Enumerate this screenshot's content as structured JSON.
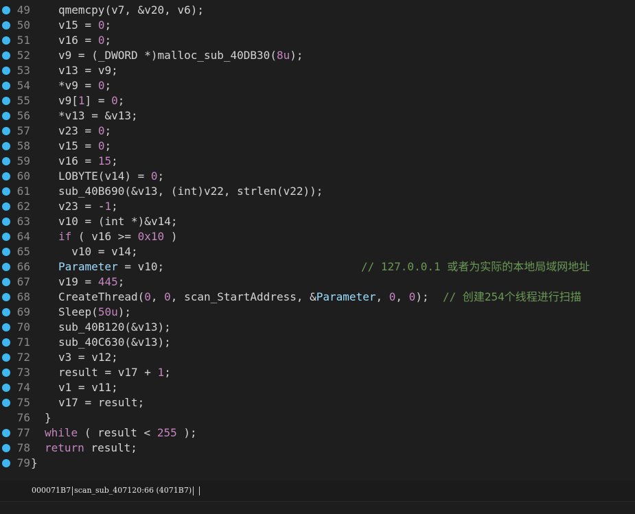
{
  "colors": {
    "background": "#1e1e1e",
    "breakpoint_dot": "#3fb7f1",
    "line_number": "#8a8a8a",
    "text": "#d4d4d4",
    "number": "#c586c0",
    "keyword": "#c586c0",
    "variable": "#9cdcfe",
    "comment": "#6a9955"
  },
  "lines": [
    {
      "num": "49",
      "bp": true,
      "text": "qmemcpy(v7, &v20, v6);"
    },
    {
      "num": "50",
      "bp": true,
      "text": "v15 = 0;"
    },
    {
      "num": "51",
      "bp": true,
      "text": "v16 = 0;"
    },
    {
      "num": "52",
      "bp": true,
      "text": "v9 = (_DWORD *)malloc_sub_40DB30(8u);"
    },
    {
      "num": "53",
      "bp": true,
      "text": "v13 = v9;"
    },
    {
      "num": "54",
      "bp": true,
      "text": "*v9 = 0;"
    },
    {
      "num": "55",
      "bp": true,
      "text": "v9[1] = 0;"
    },
    {
      "num": "56",
      "bp": true,
      "text": "*v13 = &v13;"
    },
    {
      "num": "57",
      "bp": true,
      "text": "v23 = 0;"
    },
    {
      "num": "58",
      "bp": true,
      "text": "v15 = 0;"
    },
    {
      "num": "59",
      "bp": true,
      "text": "v16 = 15;"
    },
    {
      "num": "60",
      "bp": true,
      "text": "LOBYTE(v14) = 0;"
    },
    {
      "num": "61",
      "bp": true,
      "text": "sub_40B690(&v13, (int)v22, strlen(v22));"
    },
    {
      "num": "62",
      "bp": true,
      "text": "v23 = -1;"
    },
    {
      "num": "63",
      "bp": true,
      "text": "v10 = (int *)&v14;"
    },
    {
      "num": "64",
      "bp": true,
      "text": "if ( v16 >= 0x10 )"
    },
    {
      "num": "65",
      "bp": true,
      "text": "  v10 = v14;"
    },
    {
      "num": "66",
      "bp": true,
      "text": "Parameter = v10;",
      "comment": "// 127.0.0.1 或者为实际的本地局域网地址"
    },
    {
      "num": "67",
      "bp": true,
      "text": "v19 = 445;"
    },
    {
      "num": "68",
      "bp": true,
      "text": "CreateThread(0, 0, scan_StartAddress, &Parameter, 0, 0);",
      "comment": "// 创建254个线程进行扫描"
    },
    {
      "num": "69",
      "bp": true,
      "text": "Sleep(50u);"
    },
    {
      "num": "70",
      "bp": true,
      "text": "sub_40B120(&v13);"
    },
    {
      "num": "71",
      "bp": true,
      "text": "sub_40C630(&v13);"
    },
    {
      "num": "72",
      "bp": true,
      "text": "v3 = v12;"
    },
    {
      "num": "73",
      "bp": true,
      "text": "result = v17 + 1;"
    },
    {
      "num": "74",
      "bp": true,
      "text": "v1 = v11;"
    },
    {
      "num": "75",
      "bp": true,
      "text": "v17 = result;"
    },
    {
      "num": "76",
      "bp": false,
      "text": "}"
    },
    {
      "num": "77",
      "bp": true,
      "text": "while ( result < 255 );"
    },
    {
      "num": "78",
      "bp": true,
      "text": "return result;"
    },
    {
      "num": "79",
      "bp": true,
      "text": "}"
    }
  ],
  "status": {
    "address": "000071B7",
    "location": "scan_sub_407120:66 (4071B7)"
  }
}
